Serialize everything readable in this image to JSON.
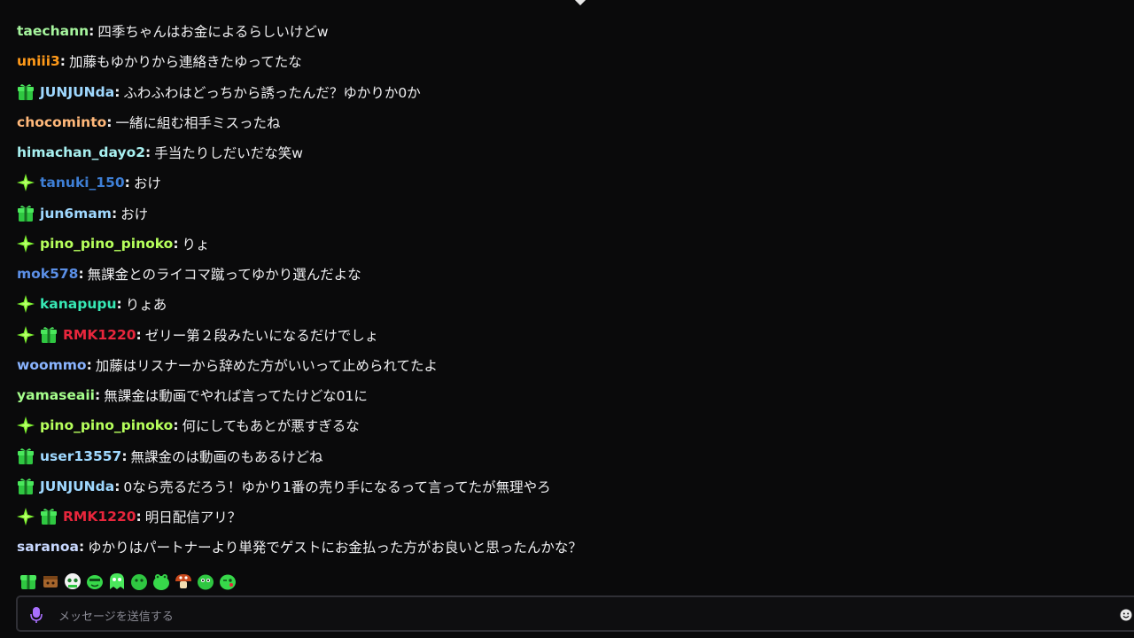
{
  "colors": {
    "background": "#0a0a0b",
    "message_text": "#efeff1",
    "placeholder": "#8a8a94",
    "mic_purple": "#a970ff",
    "badge_green": "#37d84a"
  },
  "chat": {
    "messages": [
      {
        "badges": [],
        "username": "taechann",
        "color": "#a6f59e",
        "text": "四季ちゃんはお金によるらしいけどw"
      },
      {
        "badges": [],
        "username": "uniii3",
        "color": "#ff9a1a",
        "text": "加藤もゆかりから連絡きたゆってたな"
      },
      {
        "badges": [
          "gift-icon"
        ],
        "username": "JUNJUNda",
        "color": "#9fd8ff",
        "text": "ふわふわはどっちから誘ったんだ？ゆかりか0か"
      },
      {
        "badges": [],
        "username": "chocominto",
        "color": "#ffb87a",
        "text": "一緒に組む相手ミスったね"
      },
      {
        "badges": [],
        "username": "himachan_dayo2",
        "color": "#a8f0f0",
        "text": "手当たりしだいだな笑w"
      },
      {
        "badges": [
          "sparkle-icon"
        ],
        "username": "tanuki_150",
        "color": "#3e7fd6",
        "text": "おけ"
      },
      {
        "badges": [
          "gift-icon"
        ],
        "username": "jun6mam",
        "color": "#9fd8ff",
        "text": "おけ"
      },
      {
        "badges": [
          "sparkle-icon"
        ],
        "username": "pino_pino_pinoko",
        "color": "#b6ff5c",
        "text": "りょ"
      },
      {
        "badges": [],
        "username": "mok578",
        "color": "#5b8fe6",
        "text": "無課金とのライコマ蹴ってゆかり選んだよな"
      },
      {
        "badges": [
          "sparkle-icon"
        ],
        "username": "kanapupu",
        "color": "#37e8b4",
        "text": "りょあ"
      },
      {
        "badges": [
          "sparkle-icon",
          "gift-icon"
        ],
        "username": "RMK1220",
        "color": "#e8263c",
        "text": "ゼリー第２段みたいになるだけでしょ"
      },
      {
        "badges": [],
        "username": "woommo",
        "color": "#8ab4ff",
        "text": "加藤はリスナーから辞めた方がいいって止められてたよ"
      },
      {
        "badges": [],
        "username": "yamaseaii",
        "color": "#a6ff8c",
        "text": "無課金は動画でやれば言ってたけどな01に"
      },
      {
        "badges": [
          "sparkle-icon"
        ],
        "username": "pino_pino_pinoko",
        "color": "#b6ff5c",
        "text": "何にしてもあとが悪すぎるな"
      },
      {
        "badges": [
          "gift-icon"
        ],
        "username": "user13557",
        "color": "#9fd8ff",
        "text": "無課金のは動画のもあるけどね"
      },
      {
        "badges": [
          "gift-icon"
        ],
        "username": "JUNJUNda",
        "color": "#9fd8ff",
        "text": "0なら売るだろう！ゆかり1番の売り手になるって言ってたが無理やろ"
      },
      {
        "badges": [
          "sparkle-icon",
          "gift-icon"
        ],
        "username": "RMK1220",
        "color": "#e8263c",
        "text": "明日配信アリ？"
      },
      {
        "badges": [],
        "username": "saranoa",
        "color": "#c8d8ff",
        "text": "ゆかりはパートナーより単発でゲストにお金払った方がお良いと思ったんかな？"
      }
    ]
  },
  "emote_bar": {
    "emotes": [
      "green-gift-emote",
      "brown-box-emote",
      "skull-emote",
      "green-face-emote",
      "green-ghost-emote",
      "green-blob-emote",
      "green-frog-emote",
      "mushroom-emote",
      "green-face-emote-2",
      "green-wink-emote"
    ]
  },
  "input": {
    "placeholder": "メッセージを送信する",
    "mic_icon": "microphone-icon",
    "emoji_icon": "smiley-icon"
  }
}
